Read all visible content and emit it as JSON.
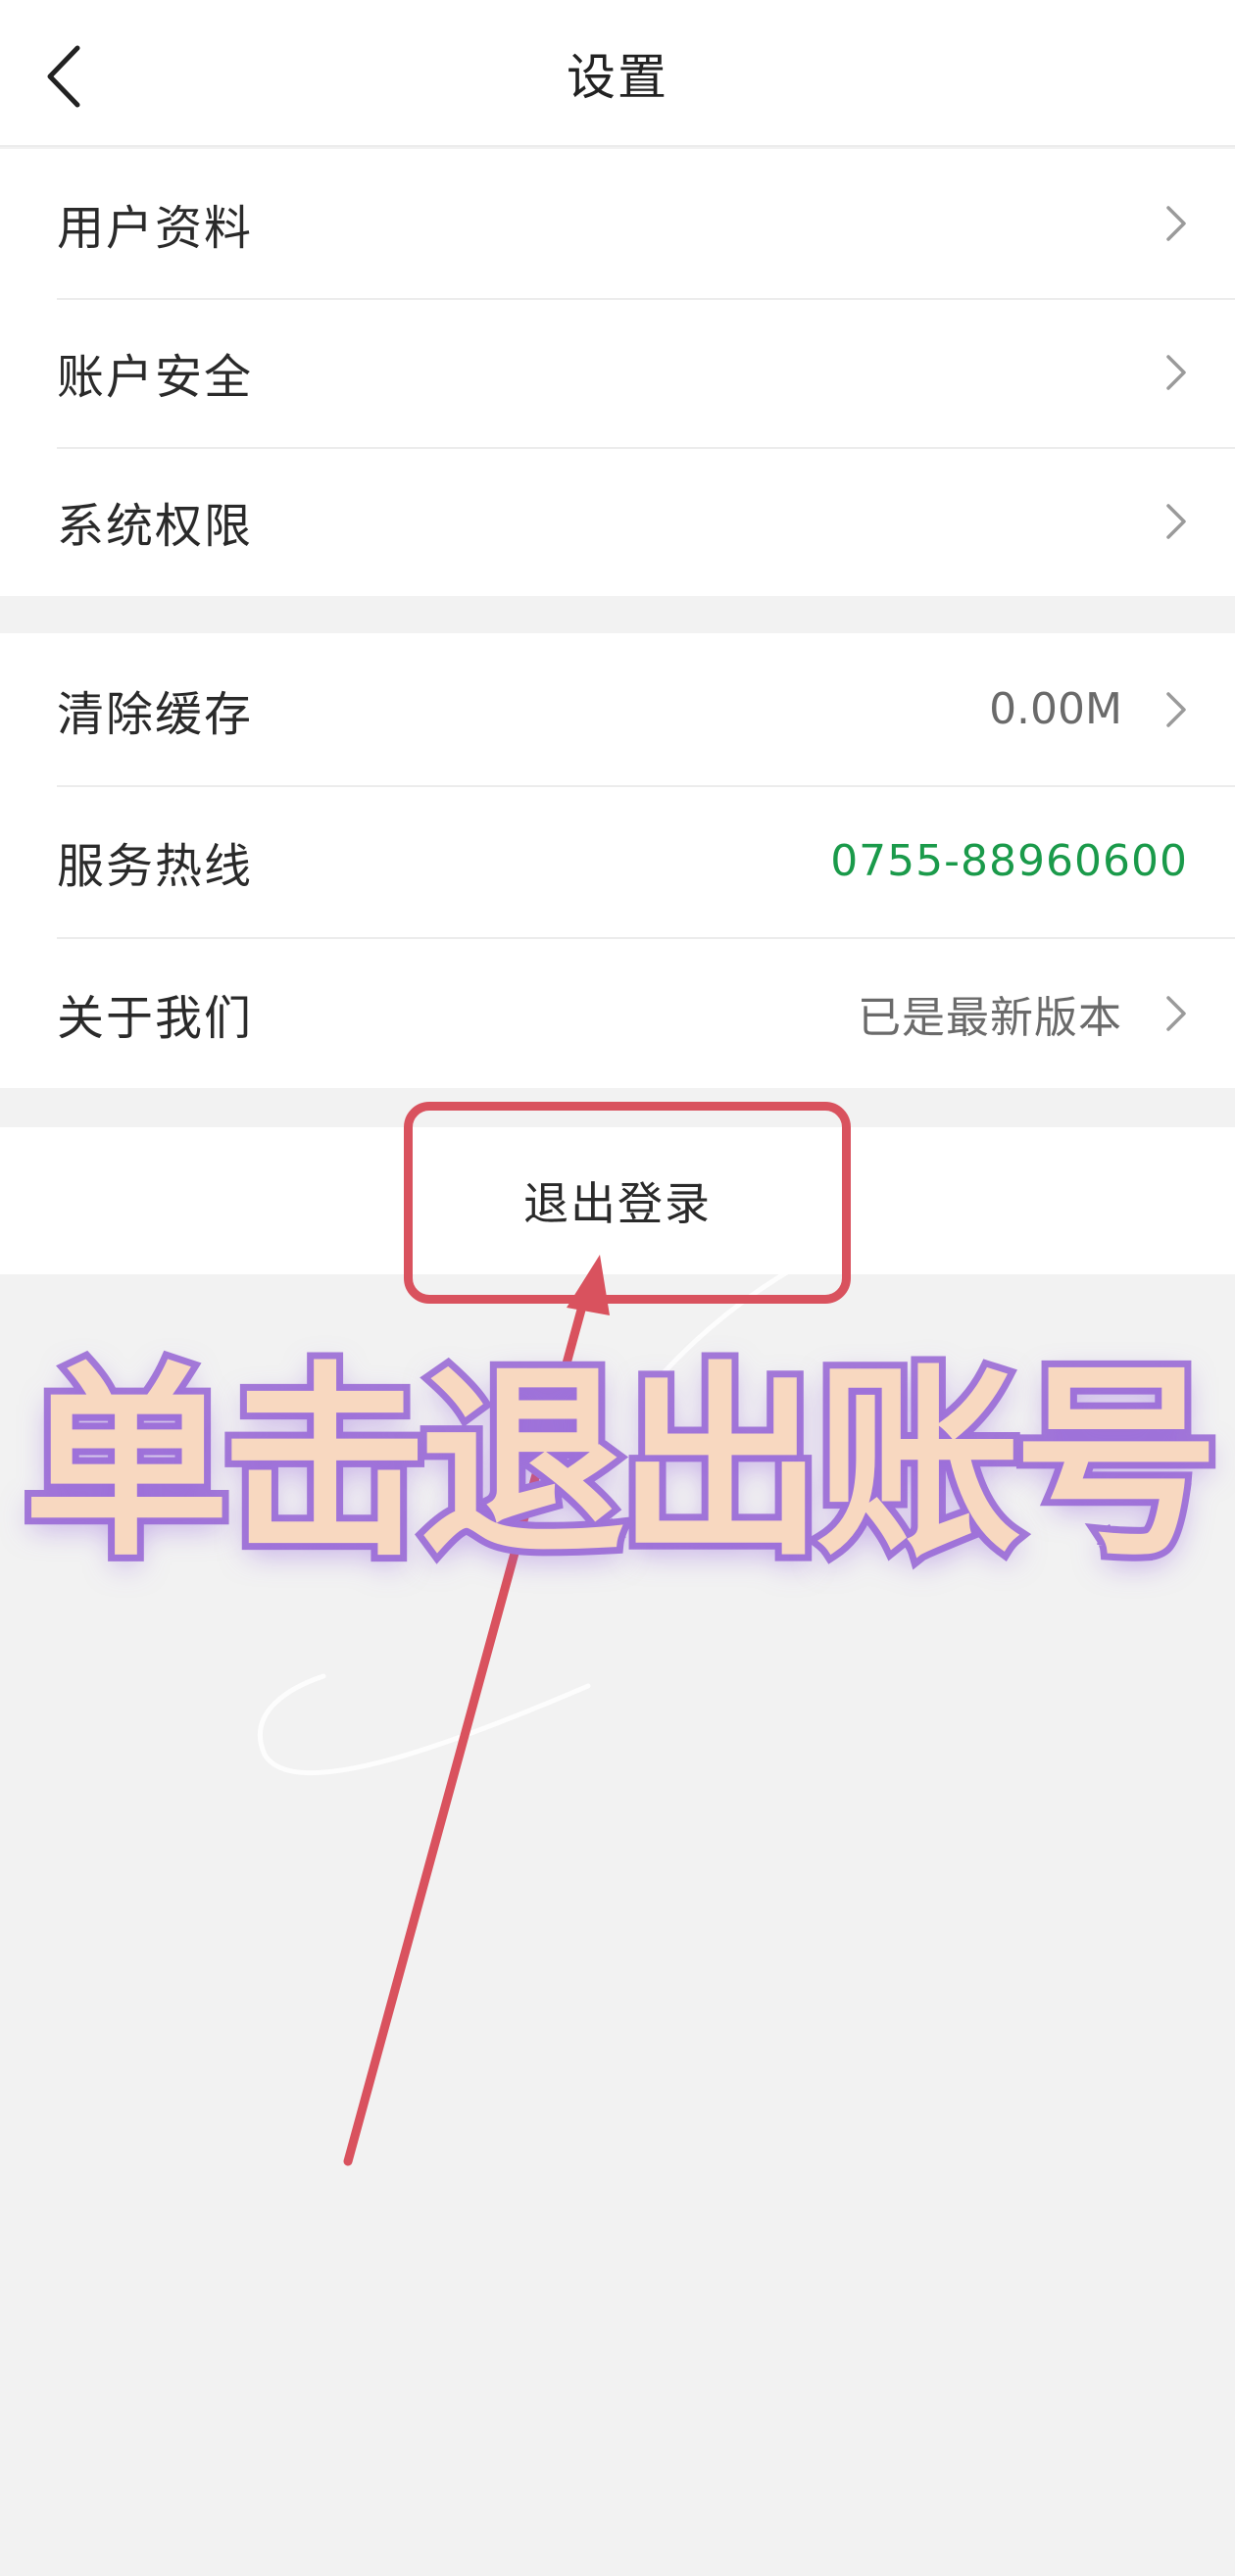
{
  "header": {
    "title": "设置",
    "back_icon": "chevron-left-icon"
  },
  "group1": {
    "items": [
      {
        "label": "用户资料"
      },
      {
        "label": "账户安全"
      },
      {
        "label": "系统权限"
      }
    ]
  },
  "group2": {
    "items": [
      {
        "label": "清除缓存",
        "value": "0.00M"
      },
      {
        "label": "服务热线",
        "value": "0755-88960600"
      },
      {
        "label": "关于我们",
        "value": "已是最新版本"
      }
    ]
  },
  "logout": {
    "label": "退出登录"
  },
  "annotation": {
    "caption": "单击退出账号",
    "highlight_color": "#d9525e",
    "caption_fill": "#f8d8c0",
    "caption_stroke": "#a47ad8"
  },
  "colors": {
    "hotline": "#1a9a4a",
    "background": "#f2f2f2"
  }
}
